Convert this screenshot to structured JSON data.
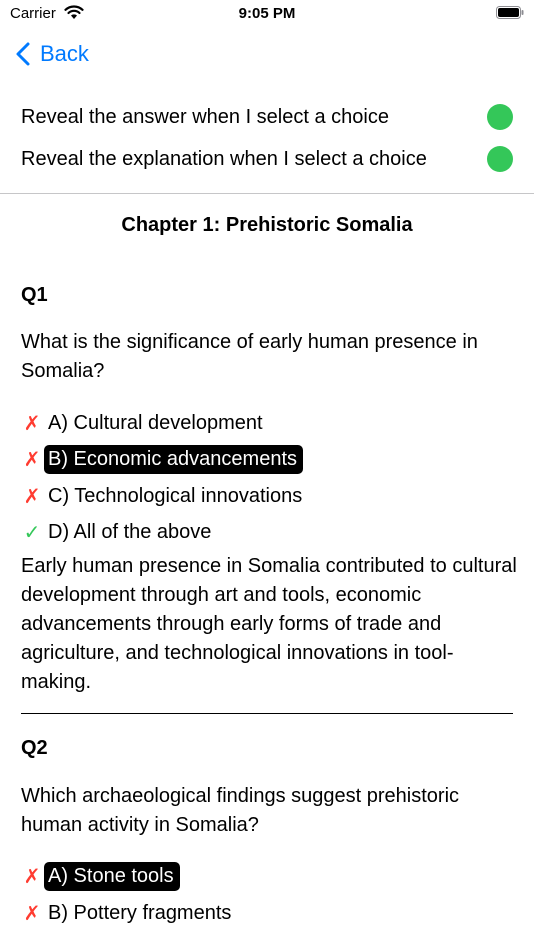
{
  "status_bar": {
    "carrier": "Carrier",
    "time": "9:05 PM"
  },
  "nav": {
    "back_label": "Back"
  },
  "settings": {
    "reveal_answer": {
      "label": "Reveal the answer when I select a choice",
      "color": "#34c759"
    },
    "reveal_explanation": {
      "label": "Reveal the explanation when I select a choice",
      "color": "#34c759"
    }
  },
  "chapter_title": "Chapter 1: Prehistoric Somalia",
  "questions": [
    {
      "label": "Q1",
      "text": "What is the significance of early human presence in Somalia?",
      "choices": [
        {
          "text": "A) Cultural development",
          "correct": false,
          "selected": false
        },
        {
          "text": "B) Economic advancements",
          "correct": false,
          "selected": true
        },
        {
          "text": "C) Technological innovations",
          "correct": false,
          "selected": false
        },
        {
          "text": "D) All of the above",
          "correct": true,
          "selected": false
        }
      ],
      "explanation": "Early human presence in Somalia contributed to cultural development through art and tools, economic advancements through early forms of trade and agriculture, and technological innovations in tool-making."
    },
    {
      "label": "Q2",
      "text": "Which archaeological findings suggest prehistoric human activity in Somalia?",
      "choices": [
        {
          "text": "A) Stone tools",
          "correct": false,
          "selected": true
        },
        {
          "text": "B) Pottery fragments",
          "correct": false,
          "selected": false
        }
      ]
    }
  ],
  "marks": {
    "wrong": "✗",
    "right": "✓"
  }
}
